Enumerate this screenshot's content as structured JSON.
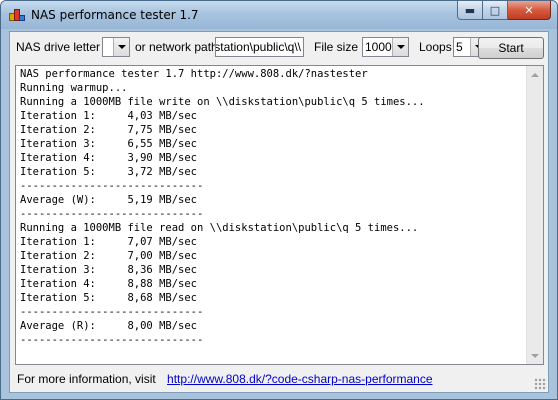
{
  "window": {
    "title": "NAS performance tester 1.7"
  },
  "toolbar": {
    "drive_label": "NAS drive letter",
    "drive_value": "",
    "network_label": "or network path",
    "network_value": "\\\\diskstation\\public\\q",
    "filesize_label": "File size",
    "filesize_value": "1000",
    "loops_label": "Loops",
    "loops_value": "5",
    "start_label": "Start"
  },
  "output": {
    "text": "NAS performance tester 1.7 http://www.808.dk/?nastester\nRunning warmup...\nRunning a 1000MB file write on \\\\diskstation\\public\\q 5 times...\nIteration 1:     4,03 MB/sec\nIteration 2:     7,75 MB/sec\nIteration 3:     6,55 MB/sec\nIteration 4:     3,90 MB/sec\nIteration 5:     3,72 MB/sec\n-----------------------------\nAverage (W):     5,19 MB/sec\n-----------------------------\nRunning a 1000MB file read on \\\\diskstation\\public\\q 5 times...\nIteration 1:     7,07 MB/sec\nIteration 2:     7,00 MB/sec\nIteration 3:     8,36 MB/sec\nIteration 4:     8,88 MB/sec\nIteration 5:     8,68 MB/sec\n-----------------------------\nAverage (R):     8,00 MB/sec\n-----------------------------"
  },
  "footer": {
    "text": "For more information, visit",
    "link_text": "http://www.808.dk/?code-csharp-nas-performance"
  },
  "icons": {
    "minimize": "minimize-icon",
    "maximize": "maximize-icon",
    "close": "close-icon"
  }
}
